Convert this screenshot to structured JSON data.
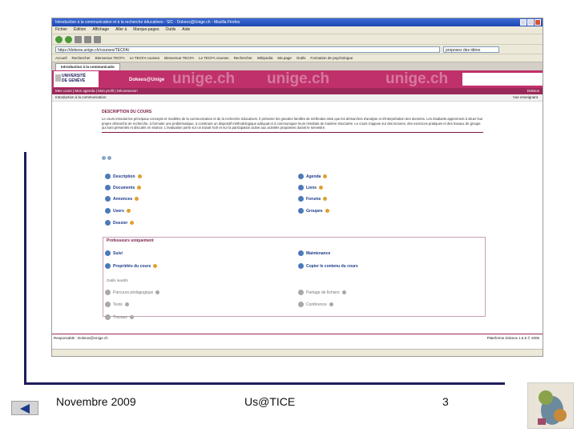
{
  "browser": {
    "window_title": "Introduction à la communication et à la recherche éducatives - SIC - Dokeos@Unige.ch - Mozilla Firefox",
    "menu": [
      "Fichier",
      "Édition",
      "Affichage",
      "Aller à",
      "Marque-pages",
      "Outils",
      "Aide"
    ],
    "address": "https://dokeos.unige.ch/courses/TECFA/",
    "search_placeholder": "proposez des idées",
    "bookmarks": [
      "Accueil",
      "Rechercher",
      "Bienvenue TECFA",
      "Le TECFA courses",
      "Bienvenue TECFA",
      "Le TECFA courses",
      "Rechercher",
      "Wikipedia",
      "Ma page",
      "Outils",
      "Formation de psychologue"
    ],
    "tabs": [
      "Introduction à la communicatio"
    ]
  },
  "site": {
    "logo_line1": "UNIVERSITÉ",
    "logo_line2": "DE GENÈVE",
    "brand": "Dokeos@Unige",
    "watermark": "unige.ch",
    "subnav_left": "Mes cours | Mon agenda | Mon profil | Déconnexion",
    "subnav_right": "Dokeos",
    "breadcrumb": "Introduction à la communication",
    "breadcrumb_right": "Vue enseignant"
  },
  "course": {
    "description_title": "DESCRIPTION DU COURS",
    "description_text": "Le cours introduit les principaux concepts et modèles de la communication et de la recherche éducatives. Il présente les grandes familles de méthodes ainsi que les démarches d'analyse et d'interprétation des données. Les étudiants apprennent à situer leur propre démarche de recherche, à formuler une problématique, à construire un dispositif méthodologique adéquat et à communiquer leurs résultats de manière structurée. Le cours s'appuie sur des lectures, des exercices pratiques et des travaux de groupe qui sont présentés et discutés en séance. L'évaluation porte sur un travail écrit et sur la participation active aux activités proposées durant le semestre."
  },
  "tools_left": [
    "Description",
    "Documents",
    "Annonces",
    "Users",
    "Dossier"
  ],
  "tools_right": [
    "Agenda",
    "Liens",
    "Forums",
    "Groupes"
  ],
  "admin": {
    "title": "Professeurs uniquement",
    "left": [
      "Suivi",
      "Propriétés du cours"
    ],
    "right": [
      "Maintenance",
      "Copier le contenu du cours"
    ],
    "inactive_label": "Outils inactifs",
    "inactive_left": [
      "Parcours pédagogique",
      "Tests",
      "Travaux"
    ],
    "inactive_right": [
      "Partage de fichiers",
      "Conférence"
    ]
  },
  "footer": {
    "left": "Responsable : Dokeos@Unige.ch",
    "right": "Plateforme Dokeos 1.6.5 © 2005"
  },
  "slide": {
    "date": "Novembre 2009",
    "center": "Us@TICE",
    "page": "3"
  },
  "colors": {
    "banner": "#c0306a",
    "accent": "#7a1a44",
    "frame": "#1c1c5a"
  }
}
